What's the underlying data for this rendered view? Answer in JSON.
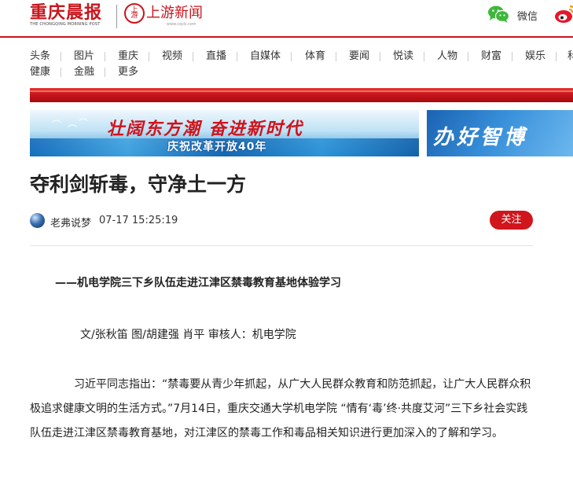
{
  "header": {
    "logo_cq": "重庆晨报",
    "logo_cq_en": "THE CHONGQING MORNING POST",
    "logo_sy_badge": "上游",
    "logo_sy": "上游新闻",
    "logo_sy_url": "www.cqcb.com",
    "wechat_label": "微信"
  },
  "nav": {
    "row1": [
      "头条",
      "图片",
      "重庆",
      "视频",
      "直播",
      "自媒体",
      "体育",
      "要闻",
      "悦读",
      "人物",
      "财富",
      "娱乐",
      "科"
    ],
    "row2": [
      "健康",
      "金融",
      "更多"
    ]
  },
  "banners": {
    "main_title": "壮阔东方潮 奋进新时代",
    "main_subtitle": "庆祝改革开放40年",
    "side_text": "办好智博"
  },
  "article": {
    "title": "夺利剑斩毒，守净土一方",
    "author": "老弗说梦",
    "time": "07-17 15:25:19",
    "follow_label": "关注",
    "subtitle": "——机电学院三下乡队伍走进江津区禁毒教育基地体验学习",
    "byline": "文/张秋笛 图/胡建强 肖平 审核人：机电学院",
    "paragraph": "习近平同志指出：“禁毒要从青少年抓起，从广大人民群众教育和防范抓起，让广大人民群众积极追求健康文明的生活方式。”7月14日，重庆交通大学机电学院 “情有‘毒’终·共度艾河”三下乡社会实践队伍走进江津区禁毒教育基地，对江津区的禁毒工作和毒品相关知识进行更加深入的了解和学习。"
  },
  "colors": {
    "brand_red": "#c8161d",
    "follow_red": "#d0151d",
    "wechat_green": "#3db83a",
    "weibo_red": "#e6162d"
  }
}
